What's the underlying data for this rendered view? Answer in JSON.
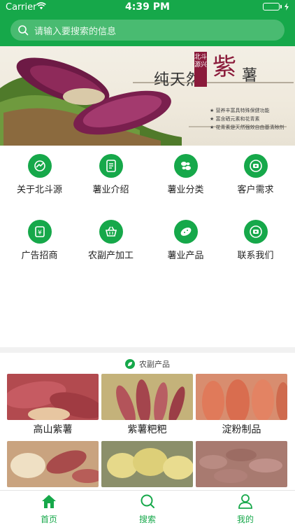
{
  "status_bar": {
    "carrier": "Carrier",
    "time": "4:39 PM"
  },
  "search": {
    "placeholder": "请输入要搜索的信息",
    "icon": "search-icon"
  },
  "banner": {
    "title": "纯天然",
    "stamp": "北斗源兴",
    "big_char": "紫",
    "big_char2": "薯",
    "bullets": [
      "营养丰富具特殊保健功能",
      "富含硒元素和花青素",
      "花青素是天然强效自由基清除剂"
    ]
  },
  "categories": [
    {
      "label": "关于北斗源",
      "icon": "chart-icon"
    },
    {
      "label": "薯业介绍",
      "icon": "document-icon"
    },
    {
      "label": "薯业分类",
      "icon": "leaves-icon"
    },
    {
      "label": "客户需求",
      "icon": "phone-icon"
    },
    {
      "label": "广告招商",
      "icon": "yen-icon"
    },
    {
      "label": "农副产加工",
      "icon": "basket-icon"
    },
    {
      "label": "薯业产品",
      "icon": "potato-icon"
    },
    {
      "label": "联系我们",
      "icon": "phone-icon"
    }
  ],
  "section": {
    "title": "农副产品"
  },
  "products": [
    {
      "label": "高山紫薯"
    },
    {
      "label": "紫薯粑粑"
    },
    {
      "label": "淀粉制品"
    },
    {
      "label": ""
    },
    {
      "label": ""
    },
    {
      "label": ""
    }
  ],
  "tabs": [
    {
      "label": "首页",
      "icon": "home-icon",
      "active": true
    },
    {
      "label": "搜索",
      "icon": "search-icon",
      "active": false
    },
    {
      "label": "我的",
      "icon": "profile-icon",
      "active": false
    }
  ],
  "colors": {
    "brand": "#16a84a",
    "active_tab": "#16a84a"
  }
}
